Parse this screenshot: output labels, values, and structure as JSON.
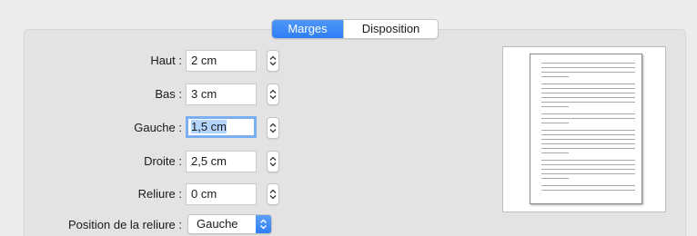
{
  "tabs": [
    {
      "label": "Marges",
      "active": true
    },
    {
      "label": "Disposition",
      "active": false
    }
  ],
  "margins": {
    "top": {
      "label": "Haut :",
      "value": "2 cm"
    },
    "bottom": {
      "label": "Bas :",
      "value": "3 cm"
    },
    "left": {
      "label": "Gauche :",
      "value": "1,5 cm"
    },
    "right": {
      "label": "Droite :",
      "value": "2,5 cm"
    },
    "gutter": {
      "label": "Reliure :",
      "value": "0 cm"
    }
  },
  "gutter_position": {
    "label": "Position de la reliure :",
    "value": "Gauche"
  },
  "colors": {
    "accent": "#2f7ef5",
    "selection": "#b3d4fd",
    "focus_ring": "#7aaef2"
  },
  "icons": {
    "stepper": "stepper-arrows-icon",
    "popup": "popup-arrows-icon"
  }
}
